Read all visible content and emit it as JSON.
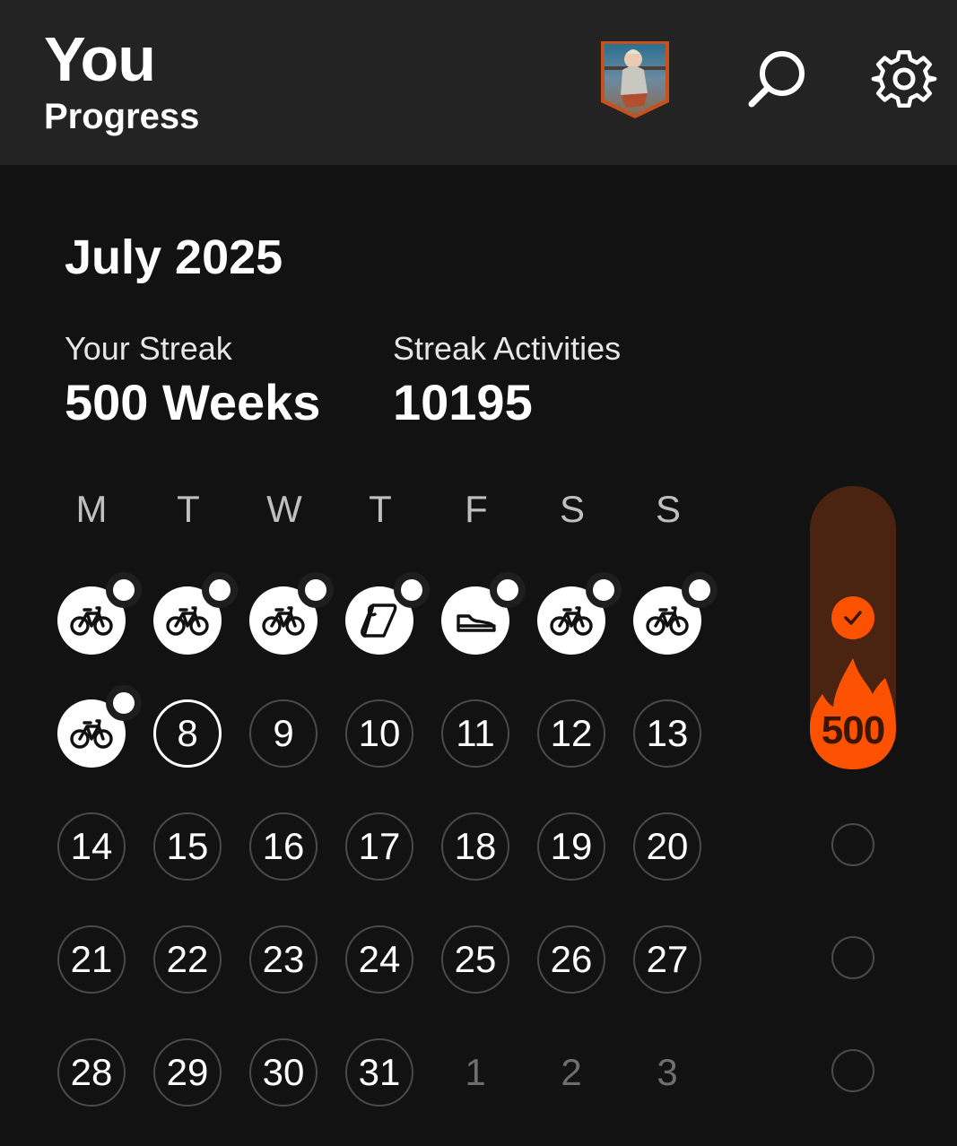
{
  "header": {
    "title": "You",
    "subtitle": "Progress"
  },
  "calendar": {
    "month_label": "July 2025",
    "streak_label": "Your Streak",
    "streak_value": "500 Weeks",
    "activities_label": "Streak Activities",
    "activities_value": "10195",
    "weekdays": [
      "M",
      "T",
      "W",
      "T",
      "F",
      "S",
      "S"
    ],
    "activity_days": [
      "ride",
      "ride",
      "ride",
      "yoga",
      "run",
      "ride",
      "ride",
      "ride"
    ],
    "days": [
      "8",
      "9",
      "10",
      "11",
      "12",
      "13",
      "14",
      "15",
      "16",
      "17",
      "18",
      "19",
      "20",
      "21",
      "22",
      "23",
      "24",
      "25",
      "26",
      "27",
      "28",
      "29",
      "30",
      "31"
    ],
    "next_month_days": [
      "1",
      "2",
      "3"
    ]
  },
  "streak": {
    "count": "500",
    "current_week_complete": true
  },
  "colors": {
    "accent": "#fc5200",
    "streak_bg": "#4a2410",
    "background": "#121212",
    "header_bg": "#232323"
  },
  "icons": [
    "bike-icon",
    "yoga-mat-icon",
    "shoe-icon",
    "search-icon",
    "gear-icon",
    "check-icon",
    "flame-icon"
  ]
}
